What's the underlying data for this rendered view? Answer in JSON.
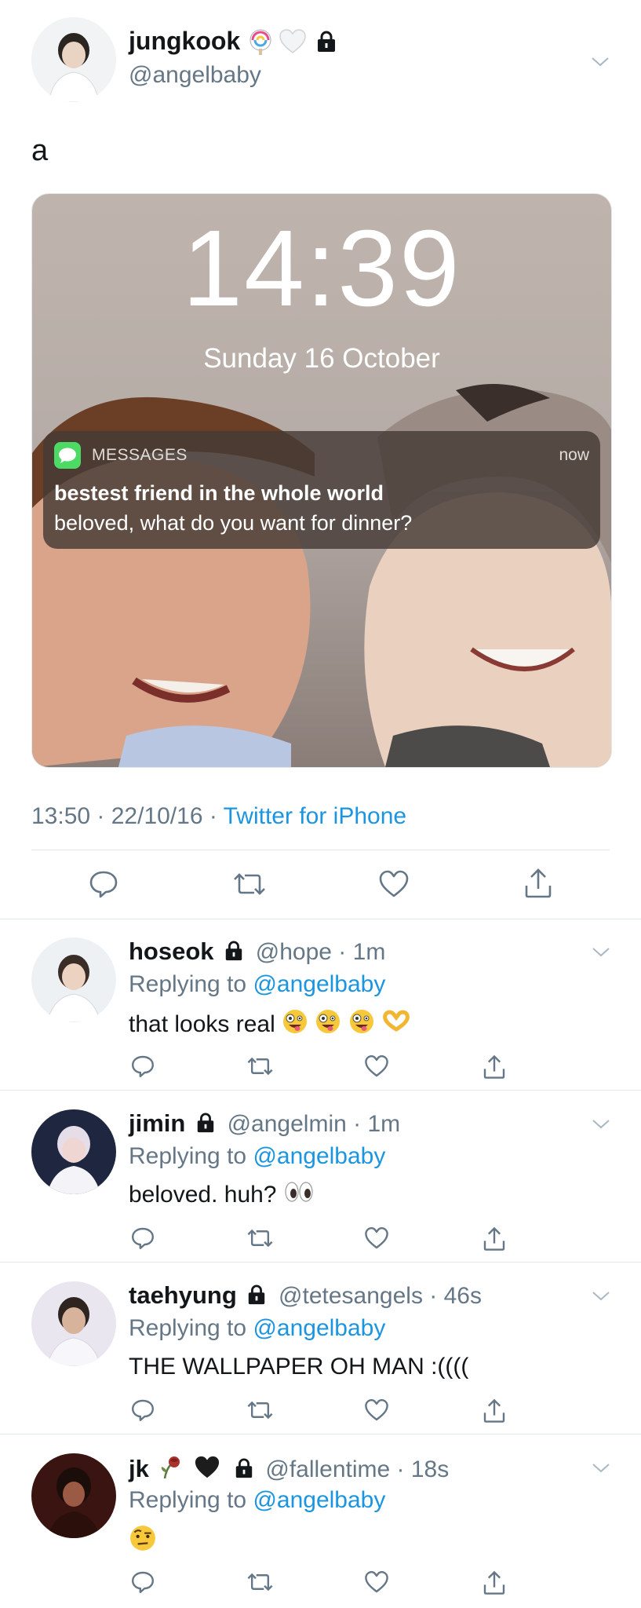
{
  "tweet": {
    "display_name": "jungkook",
    "handle": "@angelbaby",
    "text": "a",
    "timestamp": "13:50 · 22/10/16 ·",
    "source": "Twitter for iPhone",
    "icons": [
      "lollipop-emoji",
      "white-heart-emoji",
      "lock-icon",
      "chevron-down-icon"
    ]
  },
  "lockscreen": {
    "time": "14:39",
    "date": "Sunday 16 October",
    "notification": {
      "app": "MESSAGES",
      "when": "now",
      "sender": "bestest friend in the whole world",
      "message": "beloved, what do you want for dinner?"
    }
  },
  "actions": [
    "reply-icon",
    "retweet-icon",
    "like-icon",
    "share-icon"
  ],
  "replies": [
    {
      "name": "hoseok",
      "handle": "@hope · 1m",
      "replying_prefix": "Replying to",
      "replying_to": "@angelbaby",
      "text": "that looks real",
      "emoji": [
        "zany-face",
        "zany-face",
        "zany-face",
        "heart-hands"
      ]
    },
    {
      "name": "jimin",
      "handle": "@angelmin · 1m",
      "replying_prefix": "Replying to",
      "replying_to": "@angelbaby",
      "text": "beloved. huh?",
      "emoji": [
        "eyes"
      ]
    },
    {
      "name": "taehyung",
      "handle": "@tetesangels · 46s",
      "replying_prefix": "Replying to",
      "replying_to": "@angelbaby",
      "text": "THE WALLPAPER OH MAN :((((",
      "emoji": []
    },
    {
      "name": "jk",
      "handle": "@fallentime · 18s",
      "replying_prefix": "Replying to",
      "replying_to": "@angelbaby",
      "text": "",
      "emoji": [
        "raised-eyebrow-face"
      ]
    }
  ],
  "colors": {
    "link": "#1b95e0",
    "muted": "#657786",
    "text": "#14171a",
    "divider": "#e1e8ed"
  }
}
